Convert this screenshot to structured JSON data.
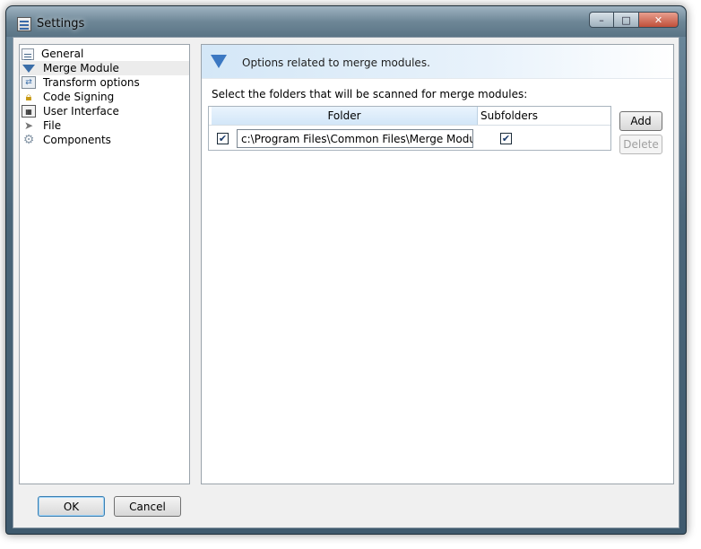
{
  "window": {
    "title": "Settings"
  },
  "caption": {
    "minimize": "–",
    "maximize": "□",
    "close": "✕"
  },
  "sidebar": {
    "items": [
      {
        "label": "General",
        "icon": "general-settings-icon"
      },
      {
        "label": "Merge Module",
        "icon": "filter-icon",
        "selected": true
      },
      {
        "label": "Transform options",
        "icon": "transform-icon"
      },
      {
        "label": "Code Signing",
        "icon": "lock-icon"
      },
      {
        "label": "User Interface",
        "icon": "user-interface-icon"
      },
      {
        "label": "File",
        "icon": "file-icon"
      },
      {
        "label": "Components",
        "icon": "gear-icon"
      }
    ]
  },
  "content": {
    "header_text": "Options related to merge modules.",
    "instruction": "Select the folders that will be scanned for merge modules:",
    "grid": {
      "columns": [
        "Folder",
        "Subfolders"
      ],
      "rows": [
        {
          "checked": true,
          "folder": "c:\\Program Files\\Common Files\\Merge Modules",
          "subfolders": true
        }
      ]
    },
    "buttons": {
      "add": "Add",
      "delete": "Delete"
    }
  },
  "footer": {
    "ok": "OK",
    "cancel": "Cancel"
  },
  "colors": {
    "accent": "#3b78c2",
    "selected_row": "#ececec"
  }
}
